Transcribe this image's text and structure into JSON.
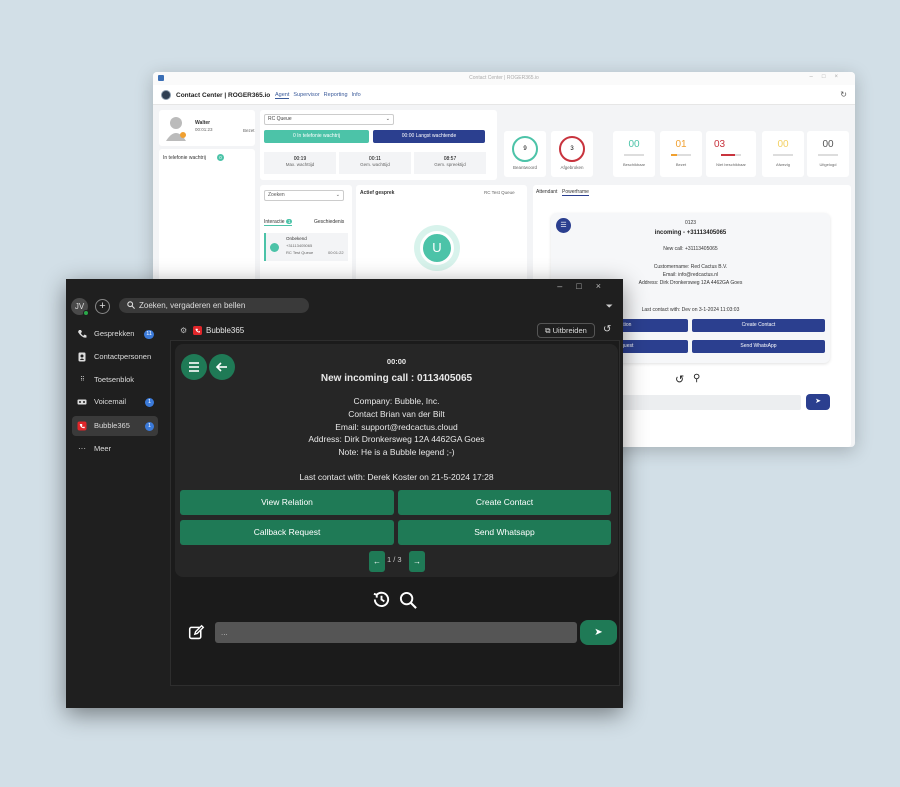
{
  "back_window": {
    "title": "Contact Center | ROGER365.io",
    "brand": "Contact Center | ROGER365.io",
    "tabs": [
      "Agent",
      "Supervisor",
      "Reporting",
      "Info"
    ],
    "agent": {
      "name": "Walter",
      "time": "00:01:23",
      "status": "Bezet"
    },
    "in_telefonie": "In telefonie wachtrij",
    "in_telefonie_count": "0",
    "queue_select": "RC Queue",
    "waiting_btn": "0  In telefonie wachtrij",
    "longest_btn": "00:00  Langst wachtende",
    "stats": [
      {
        "value": "00:19",
        "label": "Max. wachttijd"
      },
      {
        "value": "00:11",
        "label": "Gem. wachttijd"
      },
      {
        "value": "08:57",
        "label": "Gem. spreektijd"
      }
    ],
    "circles": [
      {
        "value": "9",
        "label": "Beantwoord",
        "color": "#4cc3a8"
      },
      {
        "value": "3",
        "label": "Afgebroken",
        "color": "#c8333d"
      }
    ],
    "kpis": [
      {
        "value": "00",
        "label": "Beschikbaar",
        "color": "#4cc3a8"
      },
      {
        "value": "01",
        "label": "Bezet",
        "color": "#f0a030"
      },
      {
        "value": "03",
        "label": "Niet beschikbaar",
        "color": "#c8333d"
      },
      {
        "value": "00",
        "label": "Afwezig",
        "color": "#f3d060"
      },
      {
        "value": "00",
        "label": "Uitgelogd",
        "color": "#555555"
      }
    ],
    "search_select": "Zoeken",
    "tab_interactie": "Interactie",
    "tab_interactie_count": "1",
    "tab_geschiedenis": "Geschiedenis",
    "call_item": {
      "name": "Onbekend",
      "number": "+31113405065",
      "queue": "RC Test Queue",
      "time": "00:01:22"
    },
    "actief_gesprek": "Actief gesprek",
    "actief_queue": "RC Test Queue",
    "avatar_letter": "U",
    "right_tabs": [
      "Attendant",
      "Powerframe"
    ],
    "pf": {
      "timer": "0123",
      "title": "incoming - +31113405065",
      "new_call": "New call: +31113405065",
      "lines": [
        "Customername: Red Cactus B.V.",
        "Email: info@redcactus.nl",
        "Address: Dirk Dronkersweg 12A 4462GA Goes"
      ],
      "last_contact": "Last contact with: Dev on 3-1-2024 11:03:03",
      "buttons": [
        "...elation",
        "Create Contact",
        "...Request",
        "Send WhatsApp"
      ]
    }
  },
  "front_window": {
    "avatar": "JV",
    "search_placeholder": "Zoeken, vergaderen en bellen",
    "sidebar": [
      {
        "label": "Gesprekken",
        "badge": "11",
        "icon": "phone-icon"
      },
      {
        "label": "Contactpersonen",
        "badge": "",
        "icon": "contacts-icon"
      },
      {
        "label": "Toetsenblok",
        "badge": "",
        "icon": "dialpad-icon"
      },
      {
        "label": "Voicemail",
        "badge": "1",
        "icon": "voicemail-icon"
      },
      {
        "label": "Bubble365",
        "badge": "1",
        "icon": "bubble-icon"
      },
      {
        "label": "Meer",
        "badge": "",
        "icon": "more-icon"
      }
    ],
    "app_title": "Bubble365",
    "expand_btn": "Uitbreiden",
    "card": {
      "timer": "00:00",
      "title": "New incoming call : 0113405065",
      "lines": [
        "Company: Bubble, Inc.",
        "Contact Brian van der Bilt",
        "Email: support@redcactus.cloud",
        "Address: Dirk Dronkersweg 12A 4462GA Goes",
        "Note: He is a Bubble legend ;-)"
      ],
      "last_contact": "Last contact with: Derek Koster on 21-5-2024 17:28",
      "buttons": [
        "View Relation",
        "Create Contact",
        "Callback Request",
        "Send Whatsapp"
      ],
      "pager": "1 / 3"
    },
    "input_placeholder": "..."
  }
}
